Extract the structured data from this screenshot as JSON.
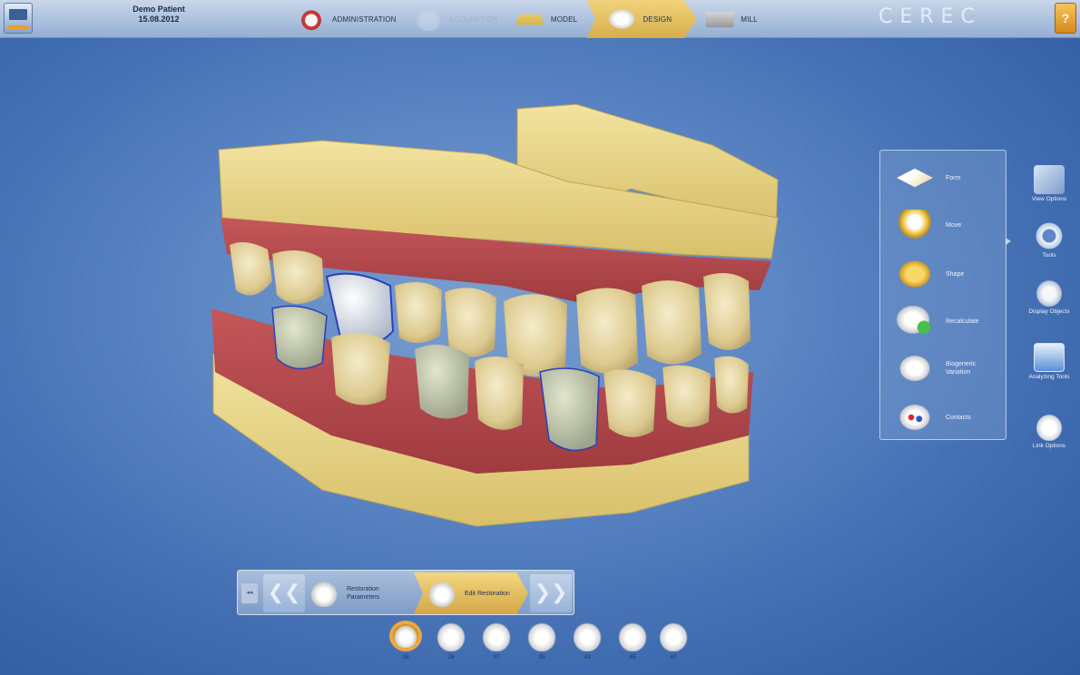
{
  "patient": {
    "name": "Demo Patient",
    "date": "15.08.2012"
  },
  "workflow": [
    {
      "label": "ADMINISTRATION",
      "state": "normal"
    },
    {
      "label": "ACQUISITION",
      "state": "disabled"
    },
    {
      "label": "MODEL",
      "state": "normal"
    },
    {
      "label": "DESIGN",
      "state": "active"
    },
    {
      "label": "MILL",
      "state": "normal"
    }
  ],
  "brand": "CEREC",
  "tools": [
    {
      "label": "Form",
      "icon": "form-icon"
    },
    {
      "label": "Move",
      "icon": "move-icon"
    },
    {
      "label": "Shape",
      "icon": "shape-icon"
    },
    {
      "label": "Recalculate",
      "icon": "recalculate-icon"
    },
    {
      "label": "Biogeneric Variation",
      "icon": "biogeneric-variation-icon"
    },
    {
      "label": "Contacts",
      "icon": "contacts-icon"
    }
  ],
  "side_tools": [
    {
      "label": "View Options",
      "icon": "view-options-icon"
    },
    {
      "label": "Tools",
      "icon": "tools-icon"
    },
    {
      "label": "Display Objects",
      "icon": "display-objects-icon"
    },
    {
      "label": "Analyzing Tools",
      "icon": "analyzing-tools-icon"
    },
    {
      "label": "Link Options",
      "icon": "link-options-icon"
    }
  ],
  "phases": {
    "mini": "◂◂",
    "back": "❮❮",
    "forward": "❯❯",
    "steps": [
      {
        "label": "Restoration Parameters",
        "state": "normal"
      },
      {
        "label": "Edit Restoration",
        "state": "active"
      }
    ]
  },
  "teeth": [
    {
      "number": "16",
      "active": true
    },
    {
      "number": "26",
      "active": false
    },
    {
      "number": "37",
      "active": false
    },
    {
      "number": "35",
      "active": false
    },
    {
      "number": "43",
      "active": false
    },
    {
      "number": "45",
      "active": false
    },
    {
      "number": "47",
      "active": false
    }
  ],
  "colors": {
    "accent": "#d7ae4c",
    "background": "#4f79bb",
    "gum": "#b8474a",
    "base": "#e9d689"
  }
}
